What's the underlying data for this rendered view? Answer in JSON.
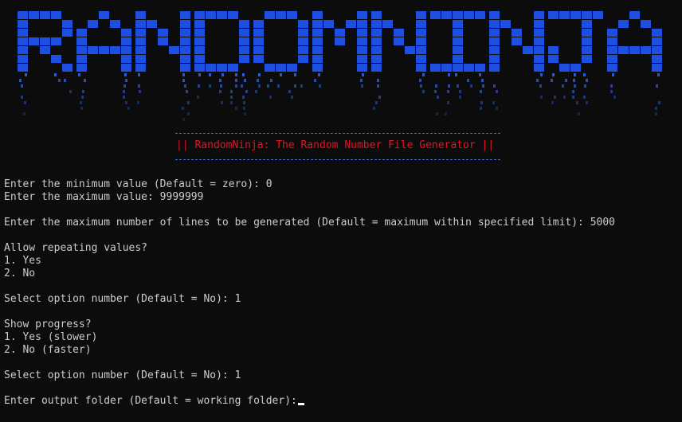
{
  "banner": {
    "text": "RANDOMNINJA",
    "color": "#1f4fe0",
    "drip_color": "#2a5ad0"
  },
  "subtitle": "|| RandomNinja: The Random Number File Generator ||",
  "colors": {
    "background": "#0c0c0c",
    "text": "#cccccc",
    "subtitle": "#e81123",
    "divider": "#3a6fd8"
  },
  "lines": [
    "Enter the minimum value (Default = zero): 0",
    "Enter the maximum value: 9999999",
    "",
    "Enter the maximum number of lines to be generated (Default = maximum within specified limit): 5000",
    "",
    "Allow repeating values?",
    "1. Yes",
    "2. No",
    "",
    "Select option number (Default = No): 1",
    "",
    "Show progress?",
    "1. Yes (slower)",
    "2. No (faster)",
    "",
    "Select option number (Default = No): 1",
    "",
    "Enter output folder (Default = working folder):"
  ]
}
